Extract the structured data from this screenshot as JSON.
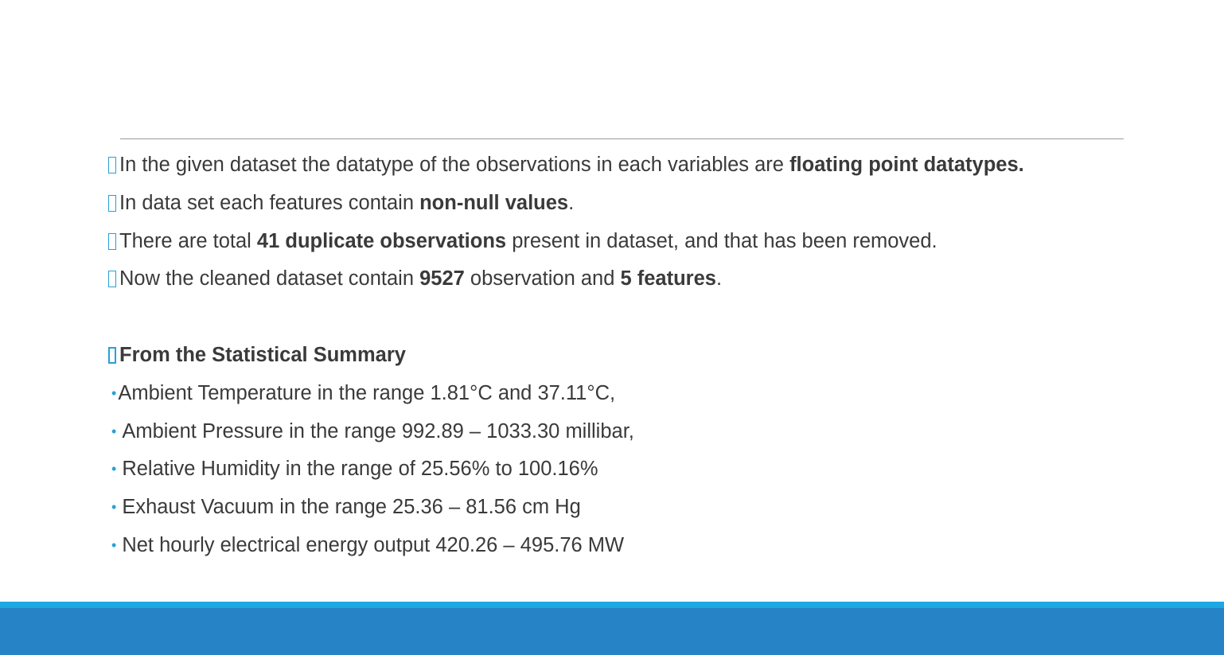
{
  "intro_points": [
    {
      "segments": [
        {
          "text": "In the given dataset the datatype of the observations in each variables are ",
          "bold": false
        },
        {
          "text": "floating point datatypes.",
          "bold": true
        }
      ]
    },
    {
      "segments": [
        {
          "text": "In data set each features contain ",
          "bold": false
        },
        {
          "text": "non-null values",
          "bold": true
        },
        {
          "text": ".",
          "bold": false
        }
      ]
    },
    {
      "segments": [
        {
          "text": "There are total ",
          "bold": false
        },
        {
          "text": "41 duplicate observations",
          "bold": true
        },
        {
          "text": " present in dataset, and that has been removed.",
          "bold": false
        }
      ]
    },
    {
      "segments": [
        {
          "text": "Now the cleaned dataset contain ",
          "bold": false
        },
        {
          "text": "9527",
          "bold": true
        },
        {
          "text": " observation and ",
          "bold": false
        },
        {
          "text": "5 features",
          "bold": true
        },
        {
          "text": ".",
          "bold": false
        }
      ]
    }
  ],
  "summary": {
    "heading": "From the Statistical Summary",
    "items": [
      {
        "text": "Ambient Temperature in the range  1.81°C and 37.11°C,"
      },
      {
        "text": "Ambient Pressure in the range  992.89 – 1033.30 millibar,"
      },
      {
        "text": "Relative Humidity  in the range of  25.56% to 100.16%"
      },
      {
        "text": "Exhaust Vacuum  in the range  25.36 – 81.56 cm Hg"
      },
      {
        "text": "Net hourly electrical energy output   420.26 –  495.76 MW"
      }
    ],
    "bullet_char": "•"
  },
  "colors": {
    "accent": "#28a0d8",
    "footer_light": "#1ca8e3",
    "footer_dark": "#2583c6",
    "text": "#3a3a3a"
  }
}
